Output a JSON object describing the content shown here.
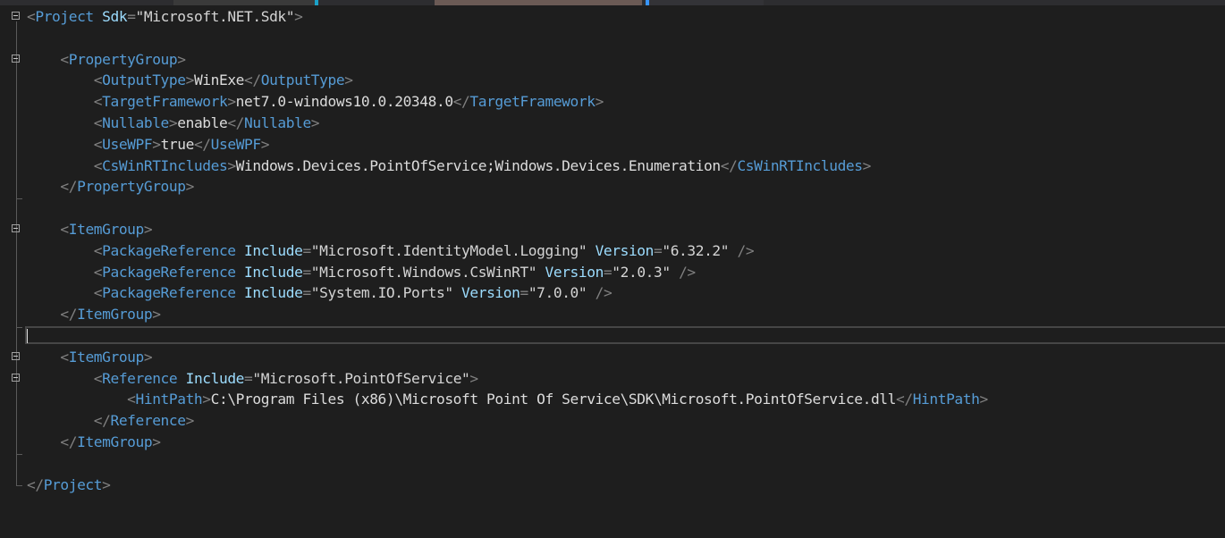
{
  "lines": [
    [
      [
        "delim",
        "<"
      ],
      [
        "tag",
        "Project"
      ],
      [
        "txt",
        " "
      ],
      [
        "attr",
        "Sdk"
      ],
      [
        "delim",
        "="
      ],
      [
        "str",
        "\"Microsoft.NET.Sdk\""
      ],
      [
        "delim",
        ">"
      ]
    ],
    [],
    [
      [
        "txt",
        "    "
      ],
      [
        "delim",
        "<"
      ],
      [
        "tag",
        "PropertyGroup"
      ],
      [
        "delim",
        ">"
      ]
    ],
    [
      [
        "txt",
        "        "
      ],
      [
        "delim",
        "<"
      ],
      [
        "tag",
        "OutputType"
      ],
      [
        "delim",
        ">"
      ],
      [
        "txt",
        "WinExe"
      ],
      [
        "delim",
        "</"
      ],
      [
        "tag",
        "OutputType"
      ],
      [
        "delim",
        ">"
      ]
    ],
    [
      [
        "txt",
        "        "
      ],
      [
        "delim",
        "<"
      ],
      [
        "tag",
        "TargetFramework"
      ],
      [
        "delim",
        ">"
      ],
      [
        "txt",
        "net7.0-windows10.0.20348.0"
      ],
      [
        "delim",
        "</"
      ],
      [
        "tag",
        "TargetFramework"
      ],
      [
        "delim",
        ">"
      ]
    ],
    [
      [
        "txt",
        "        "
      ],
      [
        "delim",
        "<"
      ],
      [
        "tag",
        "Nullable"
      ],
      [
        "delim",
        ">"
      ],
      [
        "txt",
        "enable"
      ],
      [
        "delim",
        "</"
      ],
      [
        "tag",
        "Nullable"
      ],
      [
        "delim",
        ">"
      ]
    ],
    [
      [
        "txt",
        "        "
      ],
      [
        "delim",
        "<"
      ],
      [
        "tag",
        "UseWPF"
      ],
      [
        "delim",
        ">"
      ],
      [
        "txt",
        "true"
      ],
      [
        "delim",
        "</"
      ],
      [
        "tag",
        "UseWPF"
      ],
      [
        "delim",
        ">"
      ]
    ],
    [
      [
        "txt",
        "        "
      ],
      [
        "delim",
        "<"
      ],
      [
        "tag",
        "CsWinRTIncludes"
      ],
      [
        "delim",
        ">"
      ],
      [
        "txt",
        "Windows.Devices.PointOfService;Windows.Devices.Enumeration"
      ],
      [
        "delim",
        "</"
      ],
      [
        "tag",
        "CsWinRTIncludes"
      ],
      [
        "delim",
        ">"
      ]
    ],
    [
      [
        "txt",
        "    "
      ],
      [
        "delim",
        "</"
      ],
      [
        "tag",
        "PropertyGroup"
      ],
      [
        "delim",
        ">"
      ]
    ],
    [],
    [
      [
        "txt",
        "    "
      ],
      [
        "delim",
        "<"
      ],
      [
        "tag",
        "ItemGroup"
      ],
      [
        "delim",
        ">"
      ]
    ],
    [
      [
        "txt",
        "        "
      ],
      [
        "delim",
        "<"
      ],
      [
        "tag",
        "PackageReference"
      ],
      [
        "txt",
        " "
      ],
      [
        "attr",
        "Include"
      ],
      [
        "delim",
        "="
      ],
      [
        "str",
        "\"Microsoft.IdentityModel.Logging\""
      ],
      [
        "txt",
        " "
      ],
      [
        "attr",
        "Version"
      ],
      [
        "delim",
        "="
      ],
      [
        "str",
        "\"6.32.2\""
      ],
      [
        "txt",
        " "
      ],
      [
        "delim",
        "/>"
      ]
    ],
    [
      [
        "txt",
        "        "
      ],
      [
        "delim",
        "<"
      ],
      [
        "tag",
        "PackageReference"
      ],
      [
        "txt",
        " "
      ],
      [
        "attr",
        "Include"
      ],
      [
        "delim",
        "="
      ],
      [
        "str",
        "\"Microsoft.Windows.CsWinRT\""
      ],
      [
        "txt",
        " "
      ],
      [
        "attr",
        "Version"
      ],
      [
        "delim",
        "="
      ],
      [
        "str",
        "\"2.0.3\""
      ],
      [
        "txt",
        " "
      ],
      [
        "delim",
        "/>"
      ]
    ],
    [
      [
        "txt",
        "        "
      ],
      [
        "delim",
        "<"
      ],
      [
        "tag",
        "PackageReference"
      ],
      [
        "txt",
        " "
      ],
      [
        "attr",
        "Include"
      ],
      [
        "delim",
        "="
      ],
      [
        "str",
        "\"System.IO.Ports\""
      ],
      [
        "txt",
        " "
      ],
      [
        "attr",
        "Version"
      ],
      [
        "delim",
        "="
      ],
      [
        "str",
        "\"7.0.0\""
      ],
      [
        "txt",
        " "
      ],
      [
        "delim",
        "/>"
      ]
    ],
    [
      [
        "txt",
        "    "
      ],
      [
        "delim",
        "</"
      ],
      [
        "tag",
        "ItemGroup"
      ],
      [
        "delim",
        ">"
      ]
    ],
    [],
    [
      [
        "txt",
        "    "
      ],
      [
        "delim",
        "<"
      ],
      [
        "tag",
        "ItemGroup"
      ],
      [
        "delim",
        ">"
      ]
    ],
    [
      [
        "txt",
        "        "
      ],
      [
        "delim",
        "<"
      ],
      [
        "tag",
        "Reference"
      ],
      [
        "txt",
        " "
      ],
      [
        "attr",
        "Include"
      ],
      [
        "delim",
        "="
      ],
      [
        "str",
        "\"Microsoft.PointOfService\""
      ],
      [
        "delim",
        ">"
      ]
    ],
    [
      [
        "txt",
        "            "
      ],
      [
        "delim",
        "<"
      ],
      [
        "tag",
        "HintPath"
      ],
      [
        "delim",
        ">"
      ],
      [
        "txt",
        "C:\\Program Files (x86)\\Microsoft Point Of Service\\SDK\\Microsoft.PointOfService.dll"
      ],
      [
        "delim",
        "</"
      ],
      [
        "tag",
        "HintPath"
      ],
      [
        "delim",
        ">"
      ]
    ],
    [
      [
        "txt",
        "        "
      ],
      [
        "delim",
        "</"
      ],
      [
        "tag",
        "Reference"
      ],
      [
        "delim",
        ">"
      ]
    ],
    [
      [
        "txt",
        "    "
      ],
      [
        "delim",
        "</"
      ],
      [
        "tag",
        "ItemGroup"
      ],
      [
        "delim",
        ">"
      ]
    ],
    [],
    [
      [
        "delim",
        "</"
      ],
      [
        "tag",
        "Project"
      ],
      [
        "delim",
        ">"
      ]
    ]
  ],
  "fold_lines": [
    0,
    2,
    10,
    16,
    17
  ],
  "current_line": 15
}
